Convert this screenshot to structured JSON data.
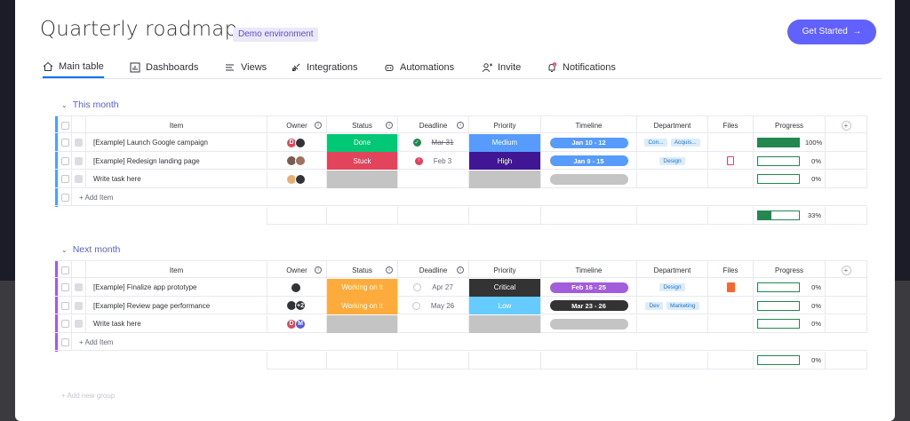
{
  "header": {
    "title": "Quarterly roadmap",
    "env_badge": "Demo environment",
    "cta_label": "Get Started",
    "cta_icon": "arrow-right-icon"
  },
  "tabs": [
    {
      "label": "Main table",
      "icon": "home-icon",
      "active": true
    },
    {
      "label": "Dashboards",
      "icon": "chart-icon"
    },
    {
      "label": "Views",
      "icon": "list-icon"
    },
    {
      "label": "Integrations",
      "icon": "integrations-icon"
    },
    {
      "label": "Automations",
      "icon": "robot-icon"
    },
    {
      "label": "Invite",
      "icon": "person-add-icon"
    },
    {
      "label": "Notifications",
      "icon": "bell-icon",
      "badge": "1"
    }
  ],
  "columns": {
    "item": "Item",
    "owner": "Owner",
    "status": "Status",
    "deadline": "Deadline",
    "priority": "Priority",
    "timeline": "Timeline",
    "department": "Department",
    "files": "Files",
    "progress": "Progress",
    "add_column_icon": "plus-circle-icon"
  },
  "colors": {
    "accent": "#6161ff",
    "done": "#00c875",
    "stuck": "#e2445c",
    "working": "#fdab3d",
    "medium": "#579bfc",
    "high": "#401694",
    "critical": "#333333",
    "low": "#66ccff",
    "empty": "#c4c4c4",
    "timeline_blue": "#579bfc",
    "timeline_purple": "#a25ddc",
    "timeline_dark": "#333333",
    "progress": "#258750",
    "group1": "#579bfc",
    "group2": "#a25ddc"
  },
  "groups": [
    {
      "title": "This month",
      "rows": [
        {
          "item": "[Example] Launch Google campaign",
          "owners": [
            {
              "initial": "D",
              "color": "#e2445c"
            },
            {
              "initial": "",
              "color": "#323338"
            }
          ],
          "status": "Done",
          "deadline": "Mar 31",
          "deadline_state": "done",
          "priority": "Medium",
          "timeline": "Jan 10 - 12",
          "departments": [
            "Con...",
            "Acquis..."
          ],
          "file": "",
          "progress": 100,
          "progress_label": "100%"
        },
        {
          "item": "[Example] Redesign landing page",
          "owners": [
            {
              "initial": "",
              "color": "#7d5a4f"
            },
            {
              "initial": "",
              "color": "#a07060"
            }
          ],
          "status": "Stuck",
          "deadline": "Feb 3",
          "deadline_state": "overdue",
          "priority": "High",
          "timeline": "Jan 9 - 15",
          "departments": [
            "Design"
          ],
          "file": "pdf",
          "progress": 0,
          "progress_label": "0%"
        },
        {
          "item": "Write task here",
          "owners": [
            {
              "initial": "",
              "color": "#e8b070"
            },
            {
              "initial": "",
              "color": "#323338"
            }
          ],
          "status": "",
          "deadline": "",
          "priority": "",
          "timeline": "",
          "departments": [],
          "file": "",
          "progress": 0,
          "progress_label": "0%"
        }
      ],
      "add_item": "+ Add Item",
      "summary_progress": 33,
      "summary_label": "33%"
    },
    {
      "title": "Next month",
      "rows": [
        {
          "item": "[Example] Finalize app prototype",
          "owners": [
            {
              "initial": "",
              "color": "#323338"
            }
          ],
          "status": "Working on it",
          "deadline": "Apr 27",
          "deadline_state": "open",
          "priority": "Critical",
          "timeline": "Feb 16 - 25",
          "departments": [
            "Design"
          ],
          "file": "doc",
          "progress": 0,
          "progress_label": "0%"
        },
        {
          "item": "[Example] Review page performance",
          "owners": [
            {
              "initial": "",
              "color": "#323338"
            },
            {
              "initial": "+2",
              "color": "#323338"
            }
          ],
          "status": "Working on it",
          "deadline": "May 26",
          "deadline_state": "open",
          "priority": "Low",
          "timeline": "Mar 23 - 26",
          "departments": [
            "Dev",
            "Marketing"
          ],
          "file": "",
          "progress": 0,
          "progress_label": "0%"
        },
        {
          "item": "Write task here",
          "owners": [
            {
              "initial": "D",
              "color": "#e2445c"
            },
            {
              "initial": "M",
              "color": "#5559df"
            }
          ],
          "status": "",
          "deadline": "",
          "priority": "",
          "timeline": "",
          "departments": [],
          "file": "",
          "progress": 0,
          "progress_label": "0%"
        }
      ],
      "add_item": "+ Add Item",
      "summary_progress": 0,
      "summary_label": "0%"
    }
  ],
  "add_group": "+ Add new group"
}
